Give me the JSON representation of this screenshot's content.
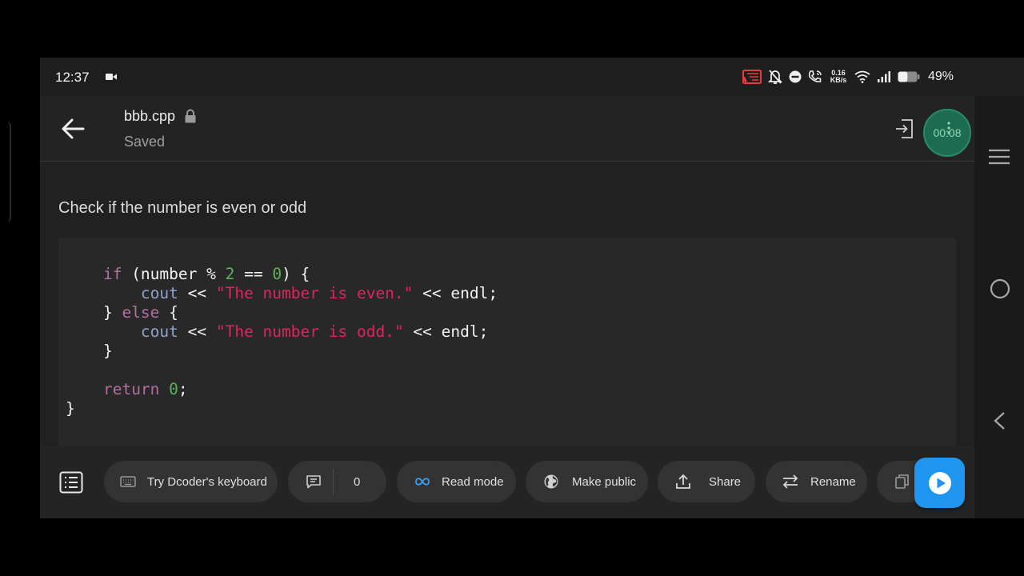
{
  "status_bar": {
    "time": "12:37",
    "net_speed_value": "0.16",
    "net_speed_unit": "KB/s",
    "battery": "49%",
    "battery_level": 0.49
  },
  "app_bar": {
    "file_name": "bbb.cpp",
    "save_status": "Saved",
    "timer": "00:08"
  },
  "content": {
    "description": "Check if the number is even or odd",
    "code": {
      "if_kw": "if",
      "cond_open": " (number % ",
      "two": "2",
      "cond_mid": " == ",
      "zero1": "0",
      "cond_close": ") {",
      "cout1": "cout",
      "op1": " << ",
      "str_even": "\"The number is even.\"",
      "end1": " << endl;",
      "brace_else_open": "} ",
      "else_kw": "else",
      "brace_else_close": " {",
      "cout2": "cout",
      "op2": " << ",
      "str_odd": "\"The number is odd.\"",
      "end2": " << endl;",
      "brace_close": "}",
      "return_kw": "return",
      "zero2": "0",
      "semi": ";",
      "final_brace": "}"
    }
  },
  "toolbar": {
    "keyboard_label": "Try Dcoder's keyboard",
    "comment_count": "0",
    "read_mode_label": "Read mode",
    "make_public_label": "Make public",
    "share_label": "Share",
    "rename_label": "Rename"
  },
  "icons": {
    "back": "arrow-left-icon",
    "lock": "lock-icon",
    "login": "login-icon",
    "menu": "menu-icon",
    "home": "circle-home-icon",
    "nav_back": "chevron-left-icon",
    "outline": "list-icon",
    "keyboard": "keyboard-icon",
    "comment": "comment-icon",
    "read": "infinity-icon",
    "public": "globe-icon",
    "share": "upload-icon",
    "rename": "swap-arrows-icon",
    "more": "copy-icon",
    "run": "play-icon"
  },
  "colors": {
    "accent": "#1e96f0",
    "timer_bg": "#1d6b50",
    "keyword": "#b36fa0",
    "string": "#e0245e",
    "number": "#5bb35b",
    "function": "#8fa3c8"
  }
}
